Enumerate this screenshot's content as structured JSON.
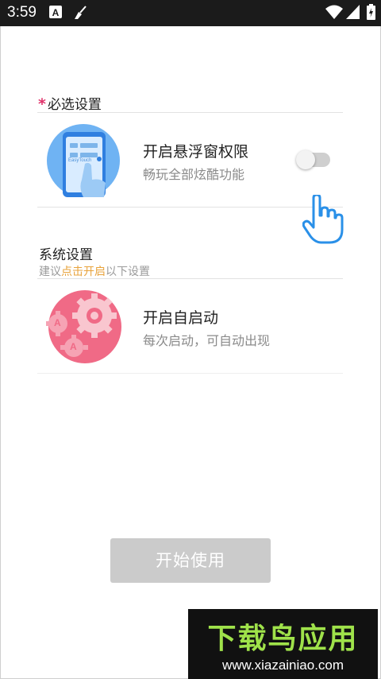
{
  "status_bar": {
    "time": "3:59",
    "icons": [
      "a-notification-icon",
      "broom-icon",
      "wifi-icon",
      "cell-signal-icon",
      "battery-charging-icon"
    ]
  },
  "required_section": {
    "star": "*",
    "title": "必选设置",
    "item": {
      "title": "开启悬浮窗权限",
      "subtitle": "畅玩全部炫酷功能",
      "illustration_text": "EasyTouch",
      "toggle_on": false
    }
  },
  "system_section": {
    "title": "系统设置",
    "hint_prefix": "建议",
    "hint_highlight": "点击开启",
    "hint_suffix": "以下设置",
    "item": {
      "title": "开启自启动",
      "subtitle": "每次启动，可自动出现",
      "gear_letter": "A"
    }
  },
  "start_button": {
    "label": "开始使用"
  },
  "watermark": {
    "title": "下载鸟应用",
    "url": "www.xiazainiao.com"
  },
  "colors": {
    "accent_star": "#e0336b",
    "hint_highlight": "#e8a33c",
    "illustration_blue": "#5aa7f0",
    "gear_pink": "#f06a86",
    "button_disabled": "#cbcbcb",
    "watermark_green": "#9fe24a"
  }
}
